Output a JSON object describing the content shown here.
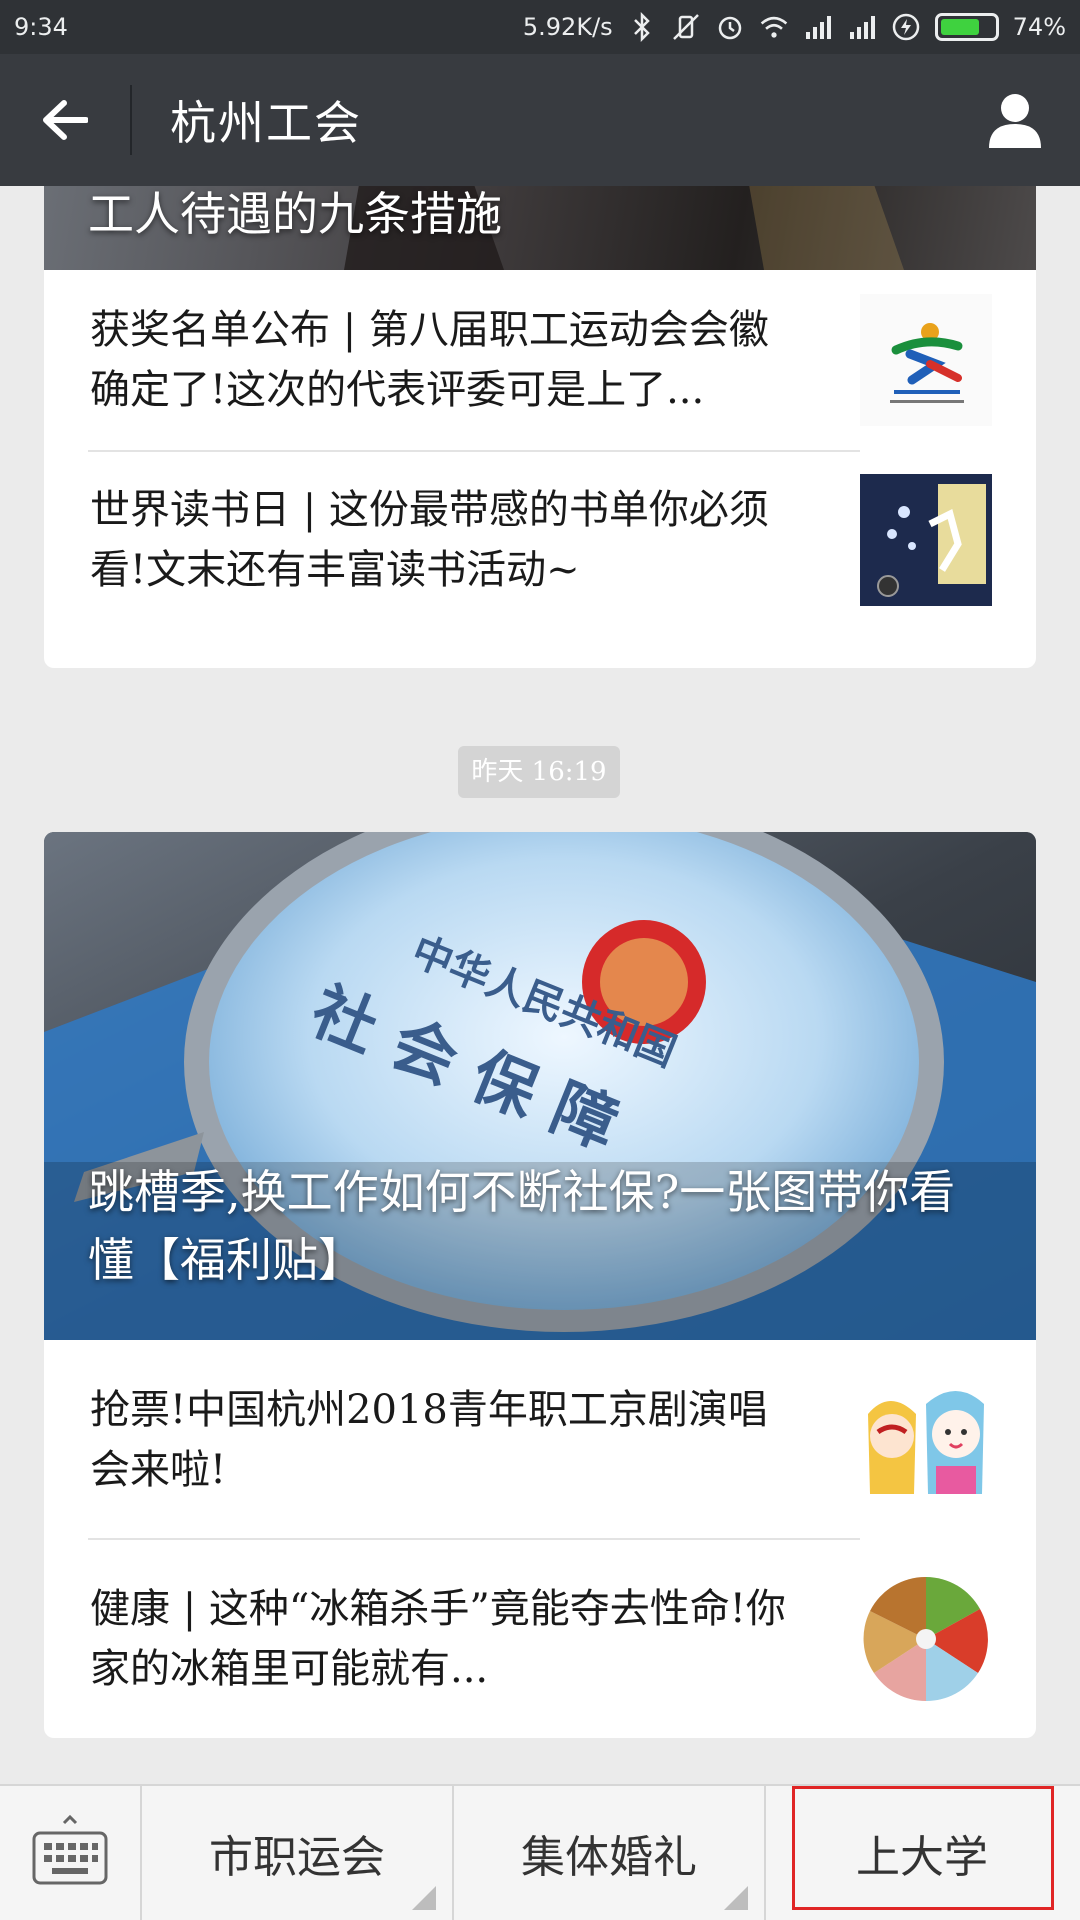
{
  "status_bar": {
    "time": "9:34",
    "net_speed": "5.92K/s",
    "battery_percent": "74%",
    "battery_level": 0.74,
    "icons": [
      "bluetooth-icon",
      "mute-vibrate-icon",
      "alarm-icon",
      "wifi-icon",
      "signal-icon",
      "signal-icon",
      "charging-icon",
      "battery-icon"
    ]
  },
  "nav": {
    "title": "杭州工会",
    "back_icon": "arrow-left-icon",
    "profile_icon": "person-icon"
  },
  "messages": [
    {
      "cover_title": "工人待遇的九条措施",
      "items": [
        {
          "title": "获奖名单公布 | 第八届职工运动会会徽确定了!这次的代表评委可是上了...",
          "thumb": "sports-games-logo"
        },
        {
          "title": "世界读书日 | 这份最带感的书单你必须看!文末还有丰富读书活动~",
          "thumb": "book-cover"
        }
      ]
    },
    {
      "timestamp": "昨天 16:19",
      "cover_title": "跳槽季,换工作如何不断社保?一张图带你看懂【福利贴】",
      "cover_image_text": "中华人民共和国 社会保障卡",
      "items": [
        {
          "title": "抢票!中国杭州2018青年职工京剧演唱会来啦!",
          "thumb": "peking-opera-illustration"
        },
        {
          "title": "健康 | 这种“冰箱杀手”竟能夺去性命!你家的冰箱里可能就有...",
          "thumb": "food-plate"
        }
      ]
    }
  ],
  "bottom_menu": {
    "keyboard_icon": "keyboard-icon",
    "items": [
      {
        "label": "市职运会",
        "has_submenu": true
      },
      {
        "label": "集体婚礼",
        "has_submenu": true
      },
      {
        "label": "上大学",
        "has_submenu": false,
        "highlighted": true
      }
    ]
  },
  "colors": {
    "nav_bg": "#383b40",
    "status_bg": "#2f3236",
    "page_bg": "#ebebeb",
    "highlight": "#e02525",
    "battery": "#3fd23f"
  }
}
